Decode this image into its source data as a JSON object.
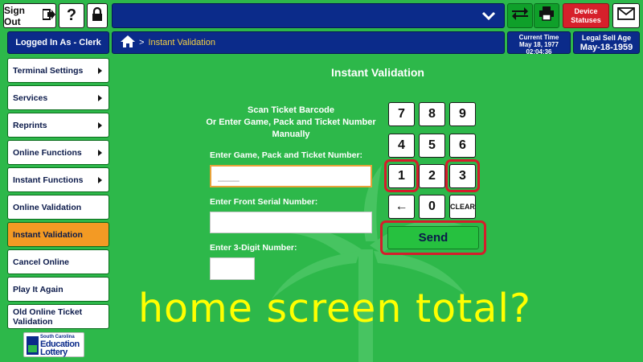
{
  "header": {
    "signout_label": "Sign Out",
    "help_label": "?",
    "device_statuses_line1": "Device",
    "device_statuses_line2": "Statuses",
    "icons": [
      "signout-arrow-icon",
      "lock-icon",
      "chevron-down-icon",
      "transfer-arrows-icon",
      "printer-icon",
      "mail-icon"
    ]
  },
  "subheader": {
    "logged_in": "Logged In As - Clerk",
    "breadcrumb_sep": ">",
    "breadcrumb": "Instant Validation",
    "current_time_label": "Current Time",
    "current_date": "May 18, 1977",
    "current_time": "02:04:36",
    "legal_sell_age_label": "Legal Sell Age",
    "legal_sell_age": "May-18-1959"
  },
  "sidebar": {
    "items": [
      {
        "label": "Terminal Settings",
        "arrow": true
      },
      {
        "label": "Services",
        "arrow": true
      },
      {
        "label": "Reprints",
        "arrow": true
      },
      {
        "label": "Online Functions",
        "arrow": true
      },
      {
        "label": "Instant Functions",
        "arrow": true
      },
      {
        "label": "Online Validation",
        "arrow": false
      },
      {
        "label": "Instant Validation",
        "arrow": false,
        "active": true
      },
      {
        "label": "Cancel Online",
        "arrow": false
      },
      {
        "label": "Play It Again",
        "arrow": false
      },
      {
        "label": "Old Online Ticket Validation",
        "arrow": false
      }
    ]
  },
  "main": {
    "title": "Instant Validation",
    "instruction_line1": "Scan Ticket Barcode",
    "instruction_line2": "Or Enter Game, Pack and Ticket Number",
    "instruction_line3": "Manually",
    "field1_label": "Enter Game, Pack and Ticket Number:",
    "field1_placeholder": "____",
    "field2_label": "Enter Front Serial Number:",
    "field3_label": "Enter 3-Digit Number:"
  },
  "keypad": {
    "keys": [
      "7",
      "8",
      "9",
      "4",
      "5",
      "6",
      "1",
      "2",
      "3",
      "←",
      "0",
      "CLEAR"
    ],
    "send_label": "Send",
    "highlighted": [
      "1",
      "3",
      "Send"
    ],
    "highlight_color": "#d61c2b"
  },
  "overlay_text": "home screen total?",
  "logo": {
    "line1": "South Carolina",
    "line2": "Education",
    "line3": "Lottery"
  },
  "colors": {
    "background": "#2db84a",
    "nav_blue": "#0b2b8a",
    "active_item": "#f39a24",
    "alert_red": "#d6202b",
    "overlay_yellow": "#ffff00"
  }
}
